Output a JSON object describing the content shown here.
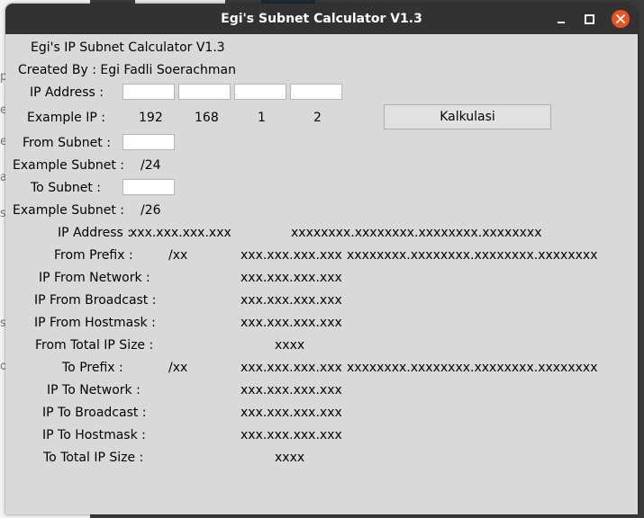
{
  "window": {
    "title": "Egi's Subnet Calculator V1.3"
  },
  "header": {
    "app_title": "Egi's IP Subnet Calculator V1.3",
    "created_by": "Created By : Egi Fadli Soerachman"
  },
  "inputs": {
    "ip_label": "IP Address :",
    "ip_octets": [
      "",
      "",
      "",
      ""
    ],
    "example_ip_label": "Example IP :",
    "example_octets": [
      "192",
      "168",
      "1",
      "2"
    ],
    "from_subnet_label": "From Subnet :",
    "from_subnet_value": "",
    "example_subnet_label": "Example Subnet :",
    "example_from_subnet": "/24",
    "to_subnet_label": "To Subnet :",
    "to_subnet_value": "",
    "example_to_subnet": "/26",
    "calc_button": "Kalkulasi"
  },
  "results": {
    "ip_address_label": "IP Address :",
    "ip_address_value": "xxx.xxx.xxx.xxx",
    "ip_address_binary": "xxxxxxxx.xxxxxxxx.xxxxxxxx.xxxxxxxx",
    "from_prefix_label": "From Prefix :",
    "from_prefix_value": "/xx",
    "from_prefix_mask": "xxx.xxx.xxx.xxx",
    "from_prefix_binary": "xxxxxxxx.xxxxxxxx.xxxxxxxx.xxxxxxxx",
    "from_network_label": "IP From Network :",
    "from_network_value": "xxx.xxx.xxx.xxx",
    "from_broadcast_label": "IP From Broadcast :",
    "from_broadcast_value": "xxx.xxx.xxx.xxx",
    "from_hostmask_label": "IP From Hostmask :",
    "from_hostmask_value": "xxx.xxx.xxx.xxx",
    "from_total_label": "From Total IP Size :",
    "from_total_value": "xxxx",
    "to_prefix_label": "To Prefix :",
    "to_prefix_value": "/xx",
    "to_prefix_mask": "xxx.xxx.xxx.xxx",
    "to_prefix_binary": "xxxxxxxx.xxxxxxxx.xxxxxxxx.xxxxxxxx",
    "to_network_label": "IP To Network :",
    "to_network_value": "xxx.xxx.xxx.xxx",
    "to_broadcast_label": "IP To Broadcast :",
    "to_broadcast_value": "xxx.xxx.xxx.xxx",
    "to_hostmask_label": "IP To Hostmask :",
    "to_hostmask_value": "xxx.xxx.xxx.xxx",
    "to_total_label": "To Total IP Size :",
    "to_total_value": "xxxx"
  },
  "colors": {
    "titlebar": "#323232",
    "close_button": "#e95420",
    "window_bg": "#d9d9d9"
  },
  "icons": {
    "minimize": "minimize-icon",
    "maximize": "maximize-icon",
    "close": "close-icon"
  }
}
